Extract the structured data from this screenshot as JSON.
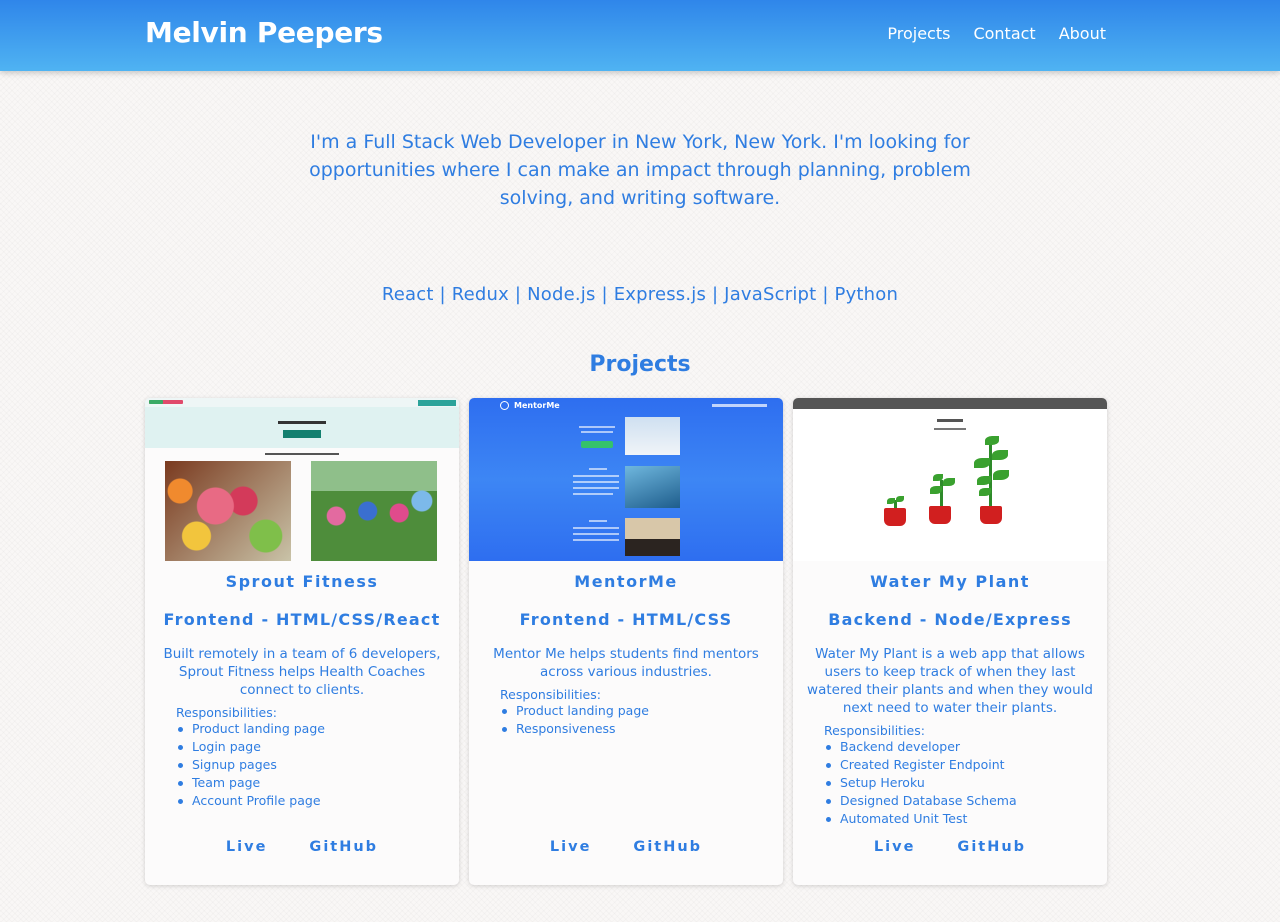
{
  "header": {
    "brand": "Melvin Peepers",
    "nav": [
      {
        "label": "Projects"
      },
      {
        "label": "Contact"
      },
      {
        "label": "About"
      }
    ]
  },
  "intro": "I'm a Full Stack Web Developer in New York, New York. I'm looking for opportunities where I can make an impact through planning, problem solving, and writing software.",
  "skills": "React | Redux | Node.js | Express.js | JavaScript | Python",
  "projects_title": "Projects",
  "projects": [
    {
      "title": "Sprout Fitness",
      "subtitle": "Frontend - HTML/CSS/React",
      "description": "Built remotely in a team of 6 developers, Sprout Fitness helps Health Coaches connect to clients.",
      "responsibilities_label": "Responsibilities:",
      "responsibilities": [
        "Product landing page",
        "Login page",
        "Signup pages",
        "Team page",
        "Account Profile page"
      ],
      "live_label": "Live",
      "github_label": "GitHub"
    },
    {
      "title": "MentorMe",
      "subtitle": "Frontend - HTML/CSS",
      "description": "Mentor Me helps students find mentors across various industries.",
      "responsibilities_label": "Responsibilities:",
      "responsibilities": [
        "Product landing page",
        "Responsiveness"
      ],
      "live_label": "Live",
      "github_label": "GitHub",
      "screenshot_logo": "MentorMe"
    },
    {
      "title": "Water My Plant",
      "subtitle": "Backend - Node/Express",
      "description": "Water My Plant is a web app that allows users to keep track of when they last watered their plants and when they would next need to water their plants.",
      "responsibilities_label": "Responsibilities:",
      "responsibilities": [
        "Backend developer",
        "Created Register Endpoint",
        "Setup Heroku",
        "Designed Database Schema",
        "Automated Unit Test"
      ],
      "live_label": "Live",
      "github_label": "GitHub"
    }
  ],
  "colors": {
    "accent": "#2f7de1",
    "header_top": "#2f86ea",
    "header_bottom": "#4fb3f2",
    "background": "#f9f7f6"
  }
}
